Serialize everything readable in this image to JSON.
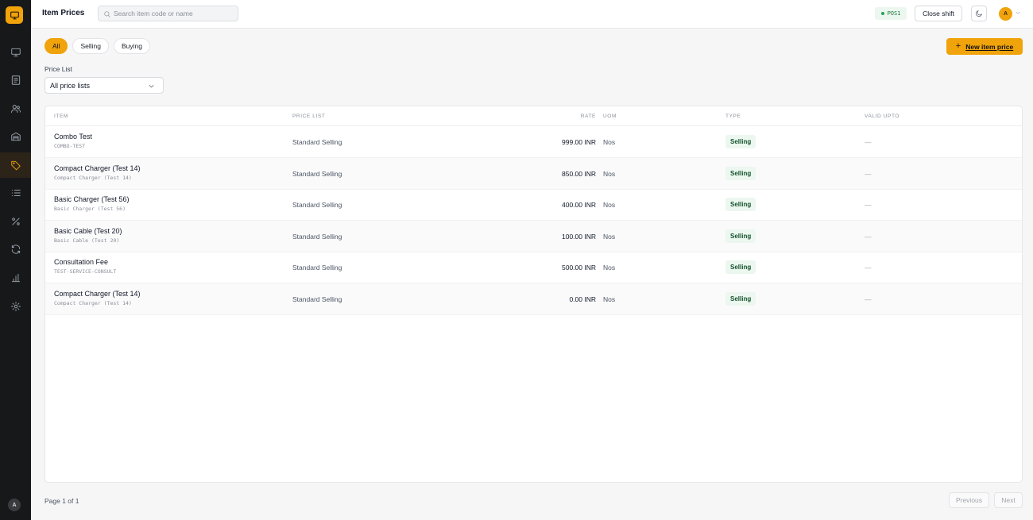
{
  "header": {
    "title": "Item Prices",
    "search_placeholder": "Search item code or name",
    "pos_label": "POS1",
    "close_shift_label": "Close shift",
    "user_initial": "A"
  },
  "sidebar": {
    "avatar_initial": "A",
    "items": [
      {
        "icon": "monitor-icon"
      },
      {
        "icon": "receipt-icon"
      },
      {
        "icon": "users-icon"
      },
      {
        "icon": "warehouse-icon"
      },
      {
        "icon": "tag-icon",
        "active": true
      },
      {
        "icon": "list-icon"
      },
      {
        "icon": "percent-icon"
      },
      {
        "icon": "refresh-icon"
      },
      {
        "icon": "bar-chart-icon"
      },
      {
        "icon": "settings-icon"
      }
    ]
  },
  "filters": {
    "tabs": [
      "All",
      "Selling",
      "Buying"
    ],
    "selected": "All"
  },
  "new_button_label": "New item price",
  "price_list": {
    "label": "Price List",
    "selected": "All price lists"
  },
  "table": {
    "columns": [
      "ITEM",
      "PRICE LIST",
      "RATE",
      "UOM",
      "TYPE",
      "VALID UPTO"
    ],
    "rows": [
      {
        "name": "Combo Test",
        "code": "COMBO-TEST",
        "price_list": "Standard Selling",
        "rate": "999.00 INR",
        "uom": "Nos",
        "type": "Selling",
        "valid_upto": "—"
      },
      {
        "name": "Compact Charger (Test 14)",
        "code": "Compact Charger (Test 14)",
        "price_list": "Standard Selling",
        "rate": "850.00 INR",
        "uom": "Nos",
        "type": "Selling",
        "valid_upto": "—"
      },
      {
        "name": "Basic Charger (Test 56)",
        "code": "Basic Charger (Test 56)",
        "price_list": "Standard Selling",
        "rate": "400.00 INR",
        "uom": "Nos",
        "type": "Selling",
        "valid_upto": "—"
      },
      {
        "name": "Basic Cable (Test 20)",
        "code": "Basic Cable (Test 20)",
        "price_list": "Standard Selling",
        "rate": "100.00 INR",
        "uom": "Nos",
        "type": "Selling",
        "valid_upto": "—"
      },
      {
        "name": "Consultation Fee",
        "code": "TEST-SERVICE-CONSULT",
        "price_list": "Standard Selling",
        "rate": "500.00 INR",
        "uom": "Nos",
        "type": "Selling",
        "valid_upto": "—"
      },
      {
        "name": "Compact Charger (Test 14)",
        "code": "Compact Charger (Test 14)",
        "price_list": "Standard Selling",
        "rate": "0.00 INR",
        "uom": "Nos",
        "type": "Selling",
        "valid_upto": "—"
      }
    ]
  },
  "pagination": {
    "info": "Page 1 of 1",
    "previous_label": "Previous",
    "next_label": "Next"
  },
  "colors": {
    "accent": "#f0a30a",
    "sidebar_bg": "#17181a",
    "badge_bg": "#ecf7ef"
  }
}
